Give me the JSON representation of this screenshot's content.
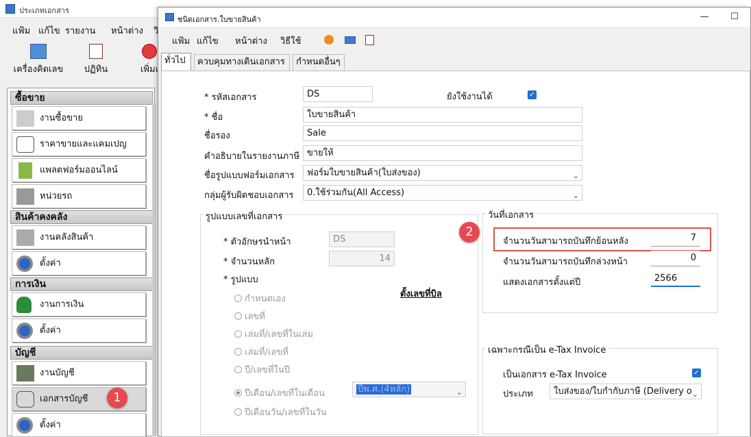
{
  "bg_window": {
    "title": "ประเภทเอกสาร",
    "menu": [
      "แฟ้ม",
      "แก้ไข",
      "รายงาน",
      "หน้าต่าง",
      "วิ"
    ],
    "toolbar": [
      "เครื่องคิดเลข",
      "ปฏิทิน",
      "เพิ่มเ"
    ]
  },
  "sidebar": {
    "sections": [
      {
        "title": "ซื้อขาย",
        "items": [
          "งานซื้อขาย",
          "ราคาขายและแคมเปญ",
          "แพลตฟอร์มออนไลน์",
          "หน่วยรถ"
        ]
      },
      {
        "title": "สินค้าคงคลัง",
        "items": [
          "งานคลังสินค้า",
          "ตั้งค่า"
        ]
      },
      {
        "title": "การเงิน",
        "items": [
          "งานการเงิน",
          "ตั้งค่า"
        ]
      },
      {
        "title": "บัญชี",
        "items": [
          "งานบัญชี",
          "เอกสารบัญชี",
          "ตั้งค่า"
        ]
      }
    ]
  },
  "badges": {
    "one": "1",
    "two": "2"
  },
  "dialog": {
    "title": "ชนิดเอกสาร.ใบขายสินค้า",
    "menu": [
      "แฟ้ม",
      "แก้ไข",
      "หน้าต่าง",
      "วิธีใช้"
    ],
    "tabs": [
      "ทั่วไป",
      "ควบคุมทางเดินเอกสาร",
      "กำหนดอื่นๆ"
    ],
    "form": {
      "code_label": "* รหัสเอกสาร",
      "code_value": "DS",
      "active_label": "ยังใช้งานได้",
      "name_label": "* ชื่อ",
      "name_value": "ใบขายสินค้า",
      "alias_label": "ชื่อรอง",
      "alias_value": "Sale",
      "desc_label": "คำอธิบายในรายงานภาษี",
      "desc_value": "ขายให้",
      "form_label": "ชื่อรูปแบบฟอร์มเอกสาร",
      "form_value": "ฟอร์มใบขายสินค้า(ใบส่งของ)",
      "group_label": "กลุ่มผู้รับผิดชอบเอกสาร",
      "group_value": "0.ใช้ร่วมกัน(All Access)"
    },
    "numbering": {
      "title": "รูปแบบเลขที่เอกสาร",
      "prefix_label": "* ตัวอักษรนำหน้า",
      "prefix_value": "DS",
      "digits_label": "* จำนวนหลัก",
      "digits_value": "14",
      "format_label": "* รูปแบบ",
      "link": "ตั้งเลขที่บิล",
      "options": [
        "กำหนดเอง",
        "เลขที่",
        "เล่มที่/เลขที่ในเล่ม",
        "เล่มที่/เลขที่",
        "ปี/เลขที่ในปี",
        "ปีเดือน/เลขที่ในเดือน",
        "ปีเดือนวัน/เลขที่ในวัน"
      ],
      "year_select": "ปีพ.ศ.(4หลัก)"
    },
    "date": {
      "title": "วันที่เอกสาร",
      "back_label": "จำนวนวันสามารถบันทึกย้อนหลัง",
      "back_value": "7",
      "fwd_label": "จำนวนวันสามารถบันทึกล่วงหน้า",
      "fwd_value": "0",
      "year_label": "แสดงเอกสารตั้งแต่ปี",
      "year_value": "2566"
    },
    "etax": {
      "title": "เฉพาะกรณีเป็น e-Tax Invoice",
      "is_label": "เป็นเอกสาร e-Tax Invoice",
      "type_label": "ประเภท",
      "type_value": "ใบส่งของ/ใบกำกับภาษี (Delivery o"
    }
  },
  "colors": {
    "accent": "#1e6fd2",
    "badge": "#e8484f",
    "highlight": "#d9534f"
  }
}
